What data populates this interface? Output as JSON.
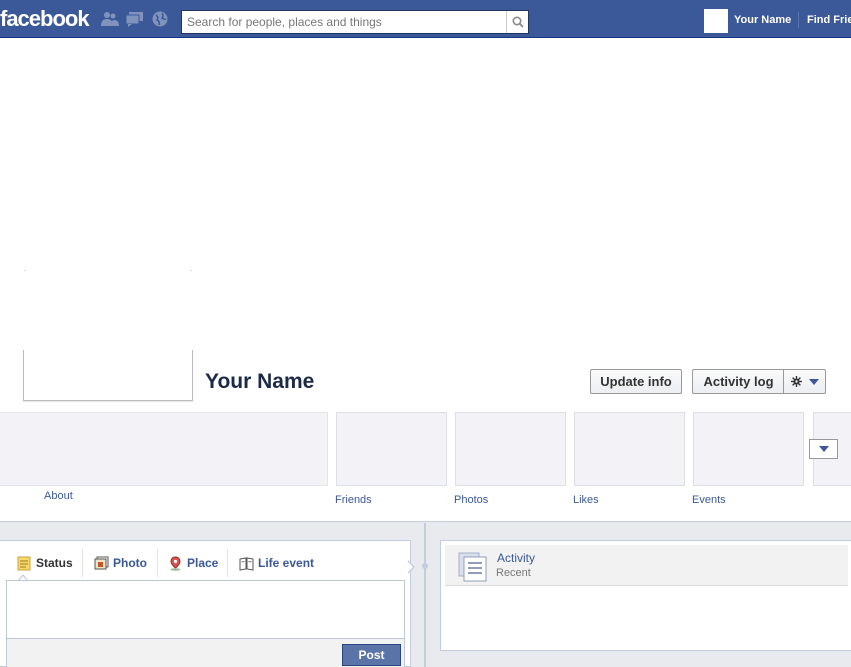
{
  "topbar": {
    "logo": "facebook",
    "search_placeholder": "Search for people, places and things",
    "user_name": "Your Name",
    "find_friends": "Find Friends"
  },
  "profile": {
    "name": "Your Name",
    "update_info": "Update info",
    "activity_log": "Activity log"
  },
  "apps": {
    "about": "About",
    "items": [
      "Friends",
      "Photos",
      "Likes",
      "Events"
    ]
  },
  "composer": {
    "tabs": [
      "Status",
      "Photo",
      "Place",
      "Life event"
    ],
    "post": "Post"
  },
  "activity": {
    "title": "Activity",
    "subtitle": "Recent"
  },
  "colors": {
    "brand_blue": "#3b5998",
    "button_blue": "#5b74a8",
    "tile_bg": "#f2f2f7"
  }
}
